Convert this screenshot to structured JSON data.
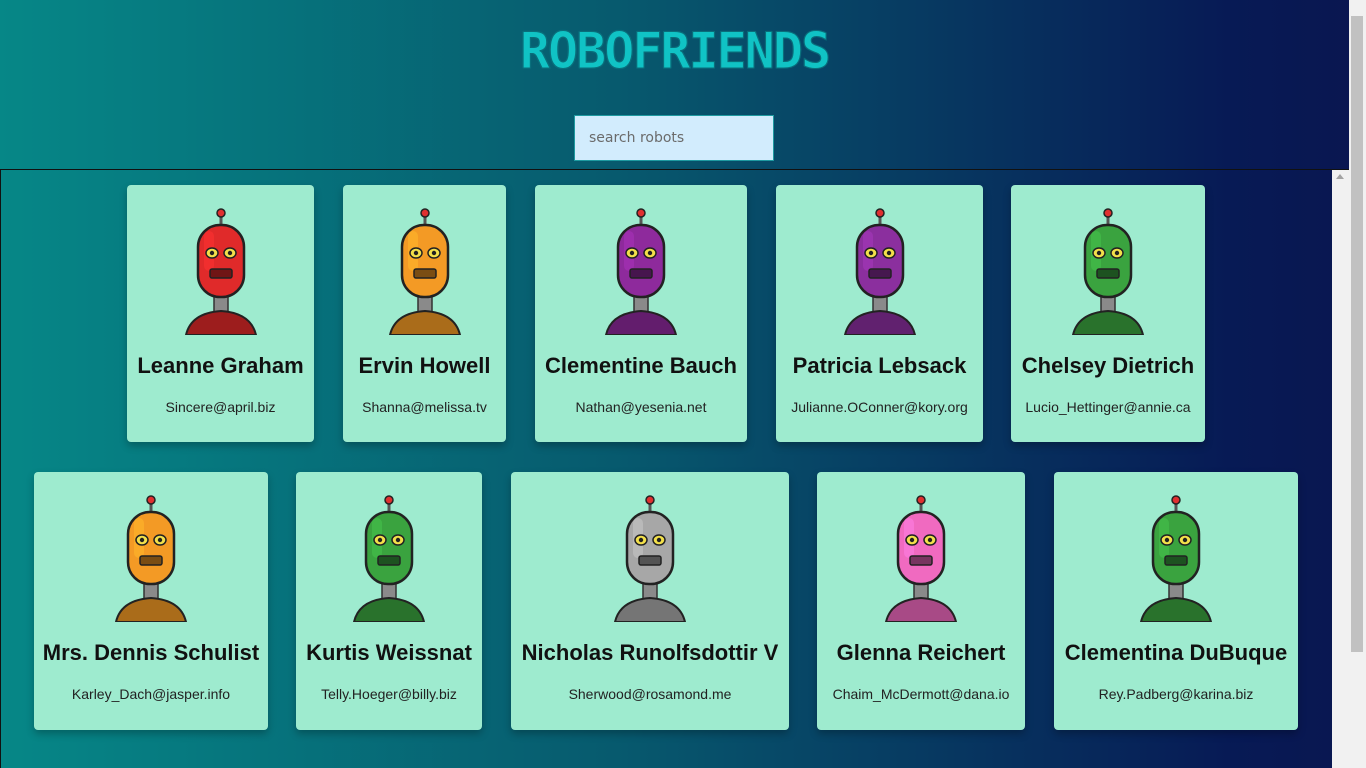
{
  "app": {
    "title": "ROBOFRIENDS"
  },
  "search": {
    "placeholder": "search robots",
    "value": ""
  },
  "robots": [
    {
      "name": "Leanne Graham",
      "email": "Sincere@april.biz",
      "color": "#e02a2a",
      "icon": "red-robot-icon"
    },
    {
      "name": "Ervin Howell",
      "email": "Shanna@melissa.tv",
      "color": "#f39a25",
      "icon": "orange-robot-icon"
    },
    {
      "name": "Clementine Bauch",
      "email": "Nathan@yesenia.net",
      "color": "#8e2a9c",
      "icon": "purple-robot-icon"
    },
    {
      "name": "Patricia Lebsack",
      "email": "Julianne.OConner@kory.org",
      "color": "#8b2f9e",
      "icon": "purple-robot-icon"
    },
    {
      "name": "Chelsey Dietrich",
      "email": "Lucio_Hettinger@annie.ca",
      "color": "#3aa33f",
      "icon": "green-robot-icon"
    },
    {
      "name": "Mrs. Dennis Schulist",
      "email": "Karley_Dach@jasper.info",
      "color": "#f39a25",
      "icon": "orange-robot-icon"
    },
    {
      "name": "Kurtis Weissnat",
      "email": "Telly.Hoeger@billy.biz",
      "color": "#3aa33f",
      "icon": "green-robot-icon"
    },
    {
      "name": "Nicholas Runolfsdottir V",
      "email": "Sherwood@rosamond.me",
      "color": "#a7a7a7",
      "icon": "gray-robot-icon"
    },
    {
      "name": "Glenna Reichert",
      "email": "Chaim_McDermott@dana.io",
      "color": "#f06ac0",
      "icon": "pink-robot-icon"
    },
    {
      "name": "Clementina DuBuque",
      "email": "Rey.Padberg@karina.biz",
      "color": "#3aa33f",
      "icon": "green-robot-icon"
    }
  ]
}
